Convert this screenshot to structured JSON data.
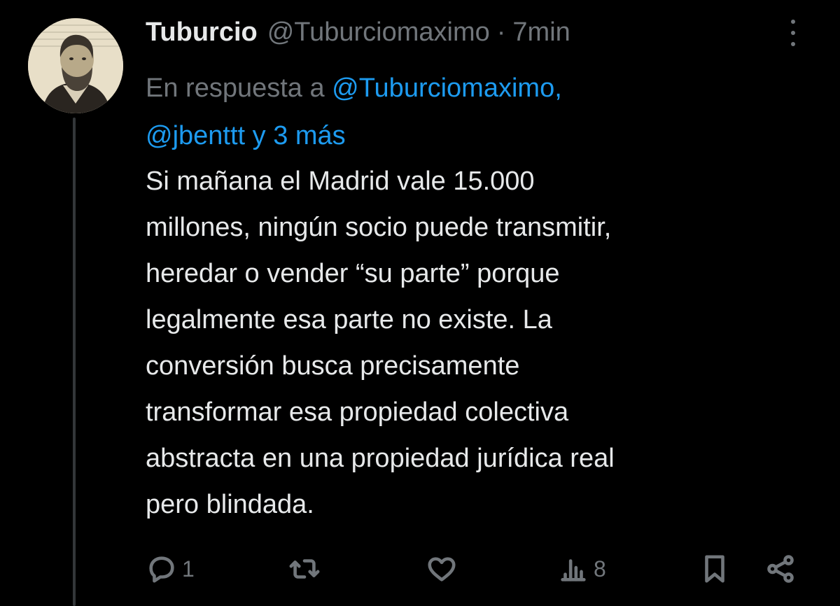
{
  "tweet": {
    "author_name": "Tuburcio",
    "handle": "@Tuburciomaximo",
    "separator": "·",
    "time": "7min",
    "reply_prefix": "En respuesta a ",
    "reply_mention_1": "@Tuburciomaximo,",
    "reply_mention_2": "@jbenttt y 3 más",
    "text": "Si mañana el Madrid vale 15.000\nmillones, ningún socio puede transmitir,\nheredar o vender “su parte” porque\nlegalmente esa parte no existe. La\nconversión busca precisamente\ntransformar esa propiedad colectiva\nabstracta en una propiedad jurídica real\npero blindada."
  },
  "actions": {
    "reply_count": "1",
    "retweet_count": "",
    "like_count": "",
    "views_count": "8"
  },
  "icons": [
    "avatar",
    "more-icon",
    "reply-icon",
    "retweet-icon",
    "like-icon",
    "views-icon",
    "bookmark-icon",
    "share-icon"
  ],
  "colors": {
    "background": "#000000",
    "text": "#e7e9ea",
    "secondary": "#71767b",
    "link": "#1d9bf0"
  }
}
